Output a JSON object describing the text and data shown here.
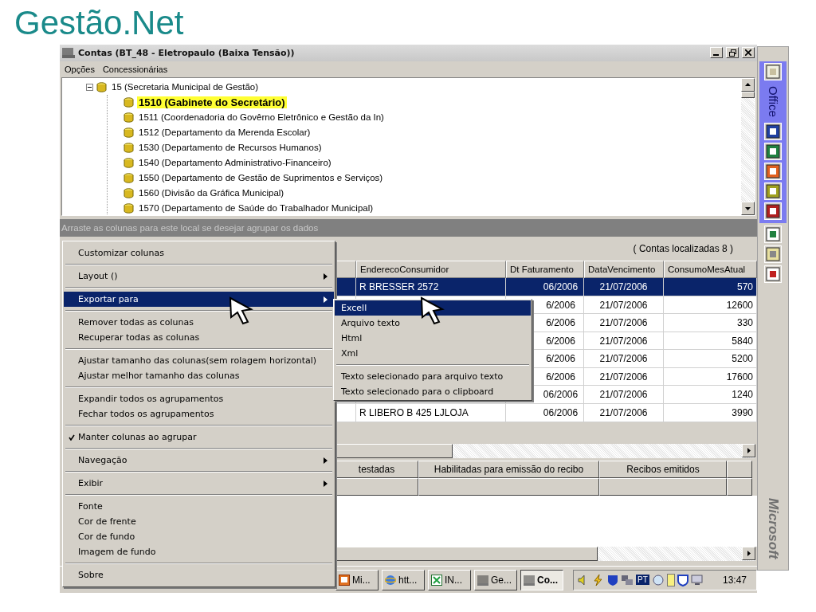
{
  "slide_title": "Gestão.Net",
  "window": {
    "title": "Contas (BT_48 - Eletropaulo (Baixa Tensão))"
  },
  "menu_bar": [
    "Opções",
    "Concessionárias"
  ],
  "tree": [
    {
      "label": "15 (Secretaria Municipal  de Gestão)",
      "expanded": true,
      "selected": false,
      "children": [
        {
          "label": "1510 (Gabinete do Secretário)",
          "selected": true
        },
        {
          "label": "1511 (Coordenadoria do Govêrno Eletrônico e Gestão da In)",
          "selected": false
        },
        {
          "label": "1512 (Departamento da Merenda Escolar)",
          "selected": false
        },
        {
          "label": "1530 (Departamento de Recursos Humanos)",
          "selected": false
        },
        {
          "label": "1540 (Departamento Administrativo-Financeiro)",
          "selected": false
        },
        {
          "label": "1550 (Departamento de Gestão de Suprimentos e Serviços)",
          "selected": false
        },
        {
          "label": "1560 (Divisão da Gráfica Municipal)",
          "selected": false
        },
        {
          "label": "1570 (Departamento de Saúde do Trabalhador Municipal)",
          "selected": false
        }
      ]
    }
  ],
  "group_panel": {
    "hint": "Arraste as colunas para este local se desejar agrupar os dados"
  },
  "grid": {
    "count": "( Contas localizadas 8 )",
    "columns": [
      "EnderecoConsumidor",
      "Dt Faturamento",
      "DataVencimento",
      "ConsumoMesAtual"
    ],
    "rows": [
      {
        "address": "R BRESSER 2572",
        "billing": "06/2006",
        "due": "21/07/2006",
        "consumption": "570",
        "selected": true
      },
      {
        "billing": "6/2006",
        "due": "21/07/2006",
        "consumption": "12600",
        "selected": false
      },
      {
        "billing": "6/2006",
        "due": "21/07/2006",
        "consumption": "330",
        "selected": false
      },
      {
        "billing": "6/2006",
        "due": "21/07/2006",
        "consumption": "5840",
        "selected": false
      },
      {
        "billing": "6/2006",
        "due": "21/07/2006",
        "consumption": "5200",
        "selected": false
      },
      {
        "billing": "6/2006",
        "due": "21/07/2006",
        "consumption": "17600",
        "selected": false
      },
      {
        "billing": "06/2006",
        "due": "21/07/2006",
        "consumption": "1240",
        "selected": false
      },
      {
        "address": "R LIBERO B 425 LJLOJA",
        "billing": "06/2006",
        "due": "21/07/2006",
        "consumption": "3990",
        "selected": false
      }
    ]
  },
  "summary_table": {
    "columns": [
      "testadas",
      "Habilitadas para emissão do recibo",
      "Recibos emitidos"
    ]
  },
  "context_menu": {
    "groups": [
      [
        {
          "label": "Customizar colunas",
          "selected": false,
          "checked": false,
          "submenu": false
        }
      ],
      [
        {
          "label": "Layout ()",
          "selected": false,
          "checked": false,
          "submenu": true
        }
      ],
      [
        {
          "label": "Exportar para",
          "selected": true,
          "checked": false,
          "submenu": true
        }
      ],
      [
        {
          "label": "Remover todas as  colunas",
          "selected": false,
          "checked": false,
          "submenu": false
        },
        {
          "label": "Recuperar todas as colunas",
          "selected": false,
          "checked": false,
          "submenu": false
        }
      ],
      [
        {
          "label": "Ajustar tamanho das colunas(sem rolagem horizontal)",
          "selected": false,
          "checked": false,
          "submenu": false
        },
        {
          "label": "Ajustar melhor tamanho das colunas",
          "selected": false,
          "checked": false,
          "submenu": false
        }
      ],
      [
        {
          "label": "Expandir todos os agrupamentos",
          "selected": false,
          "checked": false,
          "submenu": false
        },
        {
          "label": "Fechar todos os agrupamentos",
          "selected": false,
          "checked": false,
          "submenu": false
        }
      ],
      [
        {
          "label": "Manter colunas ao agrupar",
          "selected": false,
          "checked": true,
          "submenu": false
        }
      ],
      [
        {
          "label": "Navegação",
          "selected": false,
          "checked": false,
          "submenu": true
        }
      ],
      [
        {
          "label": "Exibir",
          "selected": false,
          "checked": false,
          "submenu": true
        }
      ],
      [
        {
          "label": "Fonte",
          "selected": false,
          "checked": false,
          "submenu": false
        },
        {
          "label": "Cor de frente",
          "selected": false,
          "checked": false,
          "submenu": false
        },
        {
          "label": "Cor de fundo",
          "selected": false,
          "checked": false,
          "submenu": false
        },
        {
          "label": "Imagem de fundo",
          "selected": false,
          "checked": false,
          "submenu": false
        }
      ],
      [
        {
          "label": "Sobre",
          "selected": false,
          "checked": false,
          "submenu": false
        }
      ]
    ]
  },
  "submenu": {
    "groups": [
      [
        {
          "label": "Excell",
          "selected": true
        },
        {
          "label": "Arquivo texto",
          "selected": false
        },
        {
          "label": "Html",
          "selected": false
        },
        {
          "label": "Xml",
          "selected": false
        }
      ],
      [
        {
          "label": "Texto selecionado para arquivo texto",
          "selected": false
        },
        {
          "label": "Texto selecionado para o clipboard",
          "selected": false
        }
      ]
    ]
  },
  "taskbar": {
    "buttons": [
      {
        "label": "Mi...",
        "kind": "slides",
        "selected": false
      },
      {
        "label": "htt...",
        "kind": "browser",
        "selected": false
      },
      {
        "label": "IN...",
        "kind": "sheet",
        "selected": false
      },
      {
        "label": "Ge...",
        "kind": "app",
        "selected": false
      },
      {
        "label": "Co...",
        "kind": "app",
        "selected": true
      }
    ],
    "tray_language": "PT",
    "clock": "13:47"
  },
  "office_bar": {
    "title": "Office",
    "footer": "Microsoft"
  }
}
